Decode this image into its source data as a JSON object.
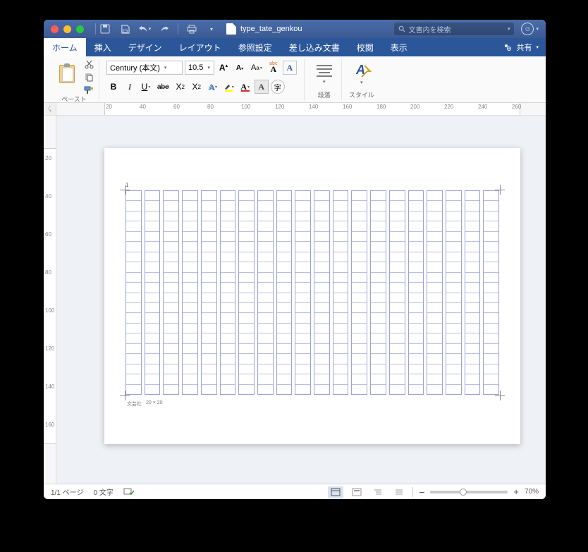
{
  "titlebar": {
    "document_name": "type_tate_genkou",
    "search_placeholder": "文書内を検索"
  },
  "tabs": {
    "items": [
      {
        "label": "ホーム",
        "active": true
      },
      {
        "label": "挿入"
      },
      {
        "label": "デザイン"
      },
      {
        "label": "レイアウト"
      },
      {
        "label": "参照設定"
      },
      {
        "label": "差し込み文書"
      },
      {
        "label": "校閲"
      },
      {
        "label": "表示"
      }
    ],
    "share_label": "共有"
  },
  "ribbon": {
    "paste_label": "ペースト",
    "font_name": "Century (本文)",
    "font_size": "10.5",
    "paragraph_label": "段落",
    "styles_label": "スタイル"
  },
  "ruler_h": {
    "labels": [
      "20",
      "40",
      "60",
      "80",
      "100",
      "120",
      "140",
      "160",
      "180",
      "200",
      "220",
      "240",
      "260"
    ]
  },
  "ruler_v": {
    "labels": [
      "20",
      "40",
      "60",
      "80",
      "100",
      "120",
      "140",
      "160"
    ]
  },
  "page": {
    "page_number_marker": "1",
    "footer_publisher": "文芸社",
    "footer_dims": "20 × 20"
  },
  "statusbar": {
    "page_info": "1/1 ページ",
    "word_count": "0 文字",
    "zoom_minus": "−",
    "zoom_plus": "+",
    "zoom_value": "70%"
  }
}
